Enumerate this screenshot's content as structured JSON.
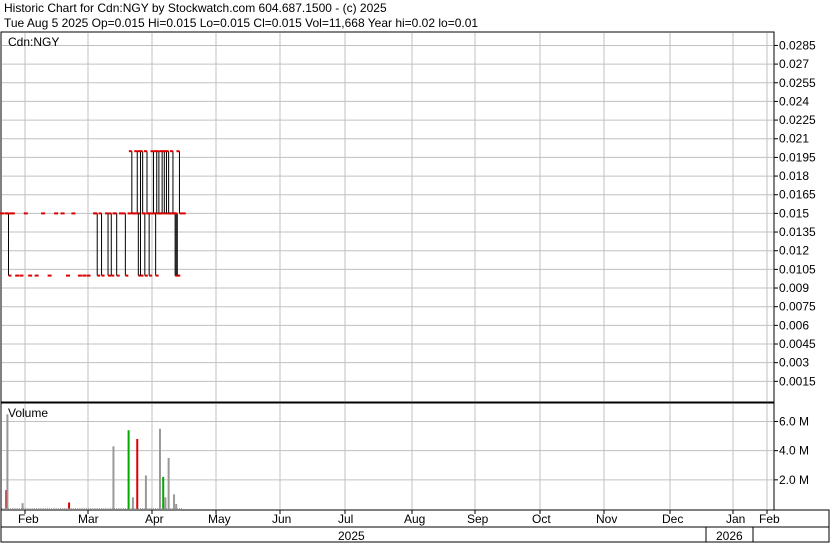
{
  "header": {
    "line1": "Historic Chart for Cdn:NGY by Stockwatch.com 604.687.1500 - (c) 2025",
    "line2": "Tue Aug  5 2025  Op=0.015  Hi=0.015  Lo=0.015  Cl=0.015  Vol=11,668  Year hi=0.02  lo=0.01"
  },
  "price_panel": {
    "symbol_label": "Cdn:NGY"
  },
  "volume_panel": {
    "label": "Volume"
  },
  "colors": {
    "up": "#00aa00",
    "down": "#dd0000",
    "flat": "#999999",
    "bar": "#000000",
    "grid": "#c0c0c0"
  },
  "chart_data": [
    {
      "type": "ohlc",
      "title": "Cdn:NGY",
      "y_ticks": [
        "0.0285",
        "0.027",
        "0.0255",
        "0.024",
        "0.0225",
        "0.021",
        "0.0195",
        "0.018",
        "0.0165",
        "0.015",
        "0.0135",
        "0.012",
        "0.0105",
        "0.009",
        "0.0075",
        "0.006",
        "0.0045",
        "0.003",
        "0.0015"
      ],
      "ylim": [
        0,
        0.0295
      ],
      "x_ticks": [
        "Feb",
        "Mar",
        "Apr",
        "May",
        "Jun",
        "Jul",
        "Aug",
        "Sep",
        "Oct",
        "Nov",
        "Dec",
        "Jan",
        "Feb"
      ],
      "x_years": [
        "2025",
        "2026"
      ],
      "bars": [
        {
          "d": 0,
          "h": 0.015,
          "l": 0.015
        },
        {
          "d": 4,
          "h": 0.015,
          "l": 0.015
        },
        {
          "d": 6,
          "h": 0.015,
          "l": 0.01
        },
        {
          "d": 8,
          "h": 0.015,
          "l": 0.015
        },
        {
          "d": 10,
          "h": 0.015,
          "l": 0.015
        },
        {
          "d": 14,
          "h": 0.01,
          "l": 0.01
        },
        {
          "d": 18,
          "h": 0.01,
          "l": 0.01
        },
        {
          "d": 22,
          "h": 0.015,
          "l": 0.015
        },
        {
          "d": 26,
          "h": 0.01,
          "l": 0.01
        },
        {
          "d": 32,
          "h": 0.01,
          "l": 0.01
        },
        {
          "d": 38,
          "h": 0.015,
          "l": 0.015
        },
        {
          "d": 44,
          "h": 0.01,
          "l": 0.01
        },
        {
          "d": 50,
          "h": 0.015,
          "l": 0.015
        },
        {
          "d": 56,
          "h": 0.015,
          "l": 0.015
        },
        {
          "d": 61,
          "h": 0.01,
          "l": 0.01
        },
        {
          "d": 66,
          "h": 0.015,
          "l": 0.015
        },
        {
          "d": 72,
          "h": 0.01,
          "l": 0.01
        },
        {
          "d": 76,
          "h": 0.01,
          "l": 0.01
        },
        {
          "d": 80,
          "h": 0.01,
          "l": 0.01
        },
        {
          "d": 86,
          "h": 0.015,
          "l": 0.015
        },
        {
          "d": 88,
          "h": 0.015,
          "l": 0.01
        },
        {
          "d": 92,
          "h": 0.015,
          "l": 0.01
        },
        {
          "d": 98,
          "h": 0.015,
          "l": 0.01
        },
        {
          "d": 101,
          "h": 0.015,
          "l": 0.01
        },
        {
          "d": 104,
          "h": 0.015,
          "l": 0.015
        },
        {
          "d": 106,
          "h": 0.015,
          "l": 0.01
        },
        {
          "d": 110,
          "h": 0.015,
          "l": 0.015
        },
        {
          "d": 114,
          "h": 0.015,
          "l": 0.01
        },
        {
          "d": 118,
          "h": 0.015,
          "l": 0.015
        },
        {
          "d": 120,
          "h": 0.02,
          "l": 0.015
        },
        {
          "d": 122,
          "h": 0.015,
          "l": 0.015
        },
        {
          "d": 125,
          "h": 0.02,
          "l": 0.015
        },
        {
          "d": 126,
          "h": 0.015,
          "l": 0.01
        },
        {
          "d": 128,
          "h": 0.02,
          "l": 0.01
        },
        {
          "d": 130,
          "h": 0.02,
          "l": 0.015
        },
        {
          "d": 132,
          "h": 0.015,
          "l": 0.01
        },
        {
          "d": 134,
          "h": 0.02,
          "l": 0.015
        },
        {
          "d": 136,
          "h": 0.015,
          "l": 0.01
        },
        {
          "d": 138,
          "h": 0.015,
          "l": 0.015
        },
        {
          "d": 140,
          "h": 0.02,
          "l": 0.015
        },
        {
          "d": 142,
          "h": 0.015,
          "l": 0.01
        },
        {
          "d": 143,
          "h": 0.02,
          "l": 0.015
        },
        {
          "d": 145,
          "h": 0.02,
          "l": 0.015
        },
        {
          "d": 146,
          "h": 0.015,
          "l": 0.015
        },
        {
          "d": 148,
          "h": 0.02,
          "l": 0.015
        },
        {
          "d": 150,
          "h": 0.02,
          "l": 0.015
        },
        {
          "d": 152,
          "h": 0.02,
          "l": 0.015
        },
        {
          "d": 154,
          "h": 0.02,
          "l": 0.015
        },
        {
          "d": 156,
          "h": 0.015,
          "l": 0.015
        },
        {
          "d": 158,
          "h": 0.02,
          "l": 0.015
        },
        {
          "d": 160,
          "h": 0.015,
          "l": 0.01
        },
        {
          "d": 161,
          "h": 0.015,
          "l": 0.01
        },
        {
          "d": 162,
          "h": 0.015,
          "l": 0.01
        },
        {
          "d": 164,
          "h": 0.02,
          "l": 0.015
        },
        {
          "d": 168,
          "h": 0.015,
          "l": 0.015
        }
      ]
    },
    {
      "type": "bar",
      "title": "Volume",
      "y_ticks": [
        "6.0 M",
        "4.0 M",
        "2.0 M"
      ],
      "ylim": [
        0,
        7200000
      ],
      "bars": [
        {
          "d": 4,
          "v": 1300000,
          "c": "down"
        },
        {
          "d": 5,
          "v": 6500000,
          "c": "flat"
        },
        {
          "d": 19,
          "v": 400000,
          "c": "flat"
        },
        {
          "d": 62,
          "v": 450000,
          "c": "down"
        },
        {
          "d": 103,
          "v": 4300000,
          "c": "flat"
        },
        {
          "d": 117,
          "v": 5400000,
          "c": "up"
        },
        {
          "d": 121,
          "v": 800000,
          "c": "flat"
        },
        {
          "d": 125,
          "v": 4800000,
          "c": "down"
        },
        {
          "d": 133,
          "v": 2300000,
          "c": "flat"
        },
        {
          "d": 146,
          "v": 5500000,
          "c": "flat"
        },
        {
          "d": 149,
          "v": 2200000,
          "c": "up"
        },
        {
          "d": 151,
          "v": 800000,
          "c": "flat"
        },
        {
          "d": 154,
          "v": 3500000,
          "c": "flat"
        },
        {
          "d": 159,
          "v": 1000000,
          "c": "flat"
        },
        {
          "d": 161,
          "v": 350000,
          "c": "flat"
        }
      ]
    }
  ]
}
